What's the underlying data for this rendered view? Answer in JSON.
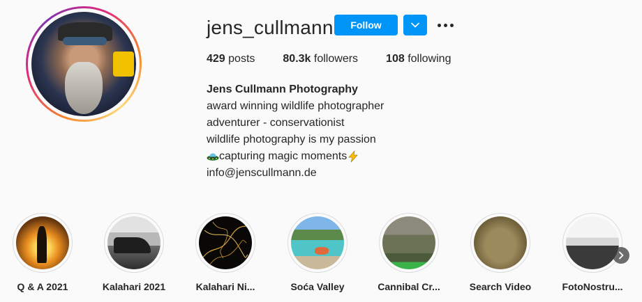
{
  "profile": {
    "username": "jens_cullmann",
    "follow_label": "Follow",
    "stats": {
      "posts_count": "429",
      "posts_label": "posts",
      "followers_count": "80.3k",
      "followers_label": "followers",
      "following_count": "108",
      "following_label": "following"
    },
    "bio": {
      "full_name": "Jens Cullmann Photography",
      "line1": "award winning wildlife photographer",
      "line2": "adventurer - conservationist",
      "line3": "wildlife photography is my passion",
      "line4": "capturing magic moments",
      "email": "info@jenscullmann.de"
    }
  },
  "highlights": [
    {
      "label": "Q & A 2021"
    },
    {
      "label": "Kalahari 2021"
    },
    {
      "label": "Kalahari Ni..."
    },
    {
      "label": "Soća Valley"
    },
    {
      "label": "Cannibal Cr..."
    },
    {
      "label": "Search Video"
    },
    {
      "label": "FotoNostru..."
    }
  ],
  "colors": {
    "accent": "#0095f6",
    "text": "#262626",
    "background": "#fafafa"
  }
}
